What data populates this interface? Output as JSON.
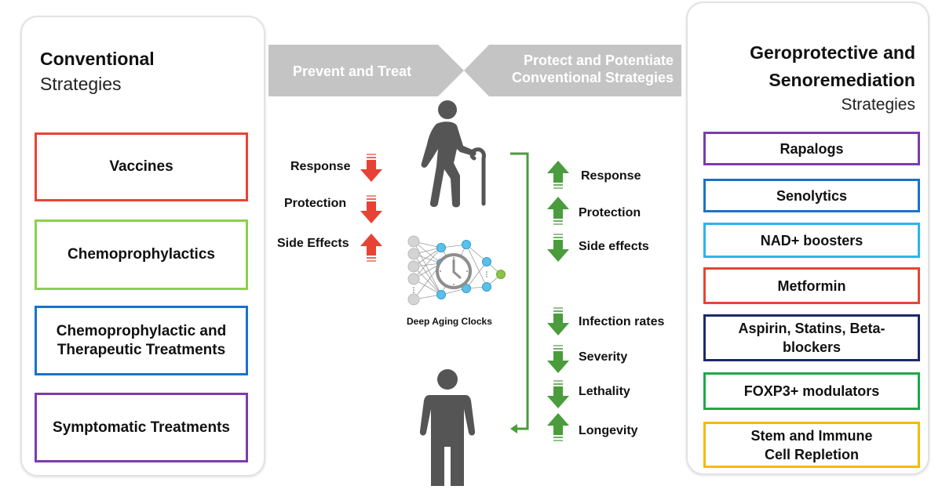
{
  "left_panel": {
    "title": "Conventional",
    "subtitle": "Strategies",
    "items": [
      {
        "label": "Vaccines",
        "color": "#ea4335"
      },
      {
        "label": "Chemoprophylactics",
        "color": "#8dd04d"
      },
      {
        "label": "Chemoprophylactic and Therapeutic Treatments",
        "color": "#1a73c9"
      },
      {
        "label": "Symptomatic Treatments",
        "color": "#7b3cb0"
      }
    ]
  },
  "banners": {
    "left": "Prevent and Treat",
    "right_line1": "Protect and Potentiate",
    "right_line2": "Conventional Strategies",
    "color": "#c4c4c4"
  },
  "center": {
    "conventional_effects": [
      {
        "label": "Response",
        "direction": "down"
      },
      {
        "label": "Protection",
        "direction": "down"
      },
      {
        "label": "Side Effects",
        "direction": "up"
      }
    ],
    "clock_label": "Deep Aging Clocks",
    "geroprotective_effects": [
      {
        "label": "Response",
        "direction": "up"
      },
      {
        "label": "Protection",
        "direction": "up"
      },
      {
        "label": "Side effects",
        "direction": "down"
      },
      {
        "label": "Infection rates",
        "direction": "down"
      },
      {
        "label": "Severity",
        "direction": "down"
      },
      {
        "label": "Lethality",
        "direction": "down"
      },
      {
        "label": "Longevity",
        "direction": "up"
      }
    ],
    "bad_color": "#e84234",
    "good_color": "#4a9c3c",
    "figure_color": "#555555"
  },
  "right_panel": {
    "title_line1": "Geroprotective and",
    "title_line2": "Senoremediation",
    "subtitle": "Strategies",
    "items": [
      {
        "label": "Rapalogs",
        "color": "#7b3cb0"
      },
      {
        "label": "Senolytics",
        "color": "#1a73c9"
      },
      {
        "label": "NAD+ boosters",
        "color": "#29b6ea"
      },
      {
        "label": "Metformin",
        "color": "#ea4335"
      },
      {
        "label": "Aspirin, Statins, Beta-blockers",
        "color": "#1a2a6c"
      },
      {
        "label": "FOXP3+ modulators",
        "color": "#1fa84a"
      },
      {
        "label": "Stem and Immune Cell Repletion",
        "color": "#f6b90c"
      }
    ]
  }
}
